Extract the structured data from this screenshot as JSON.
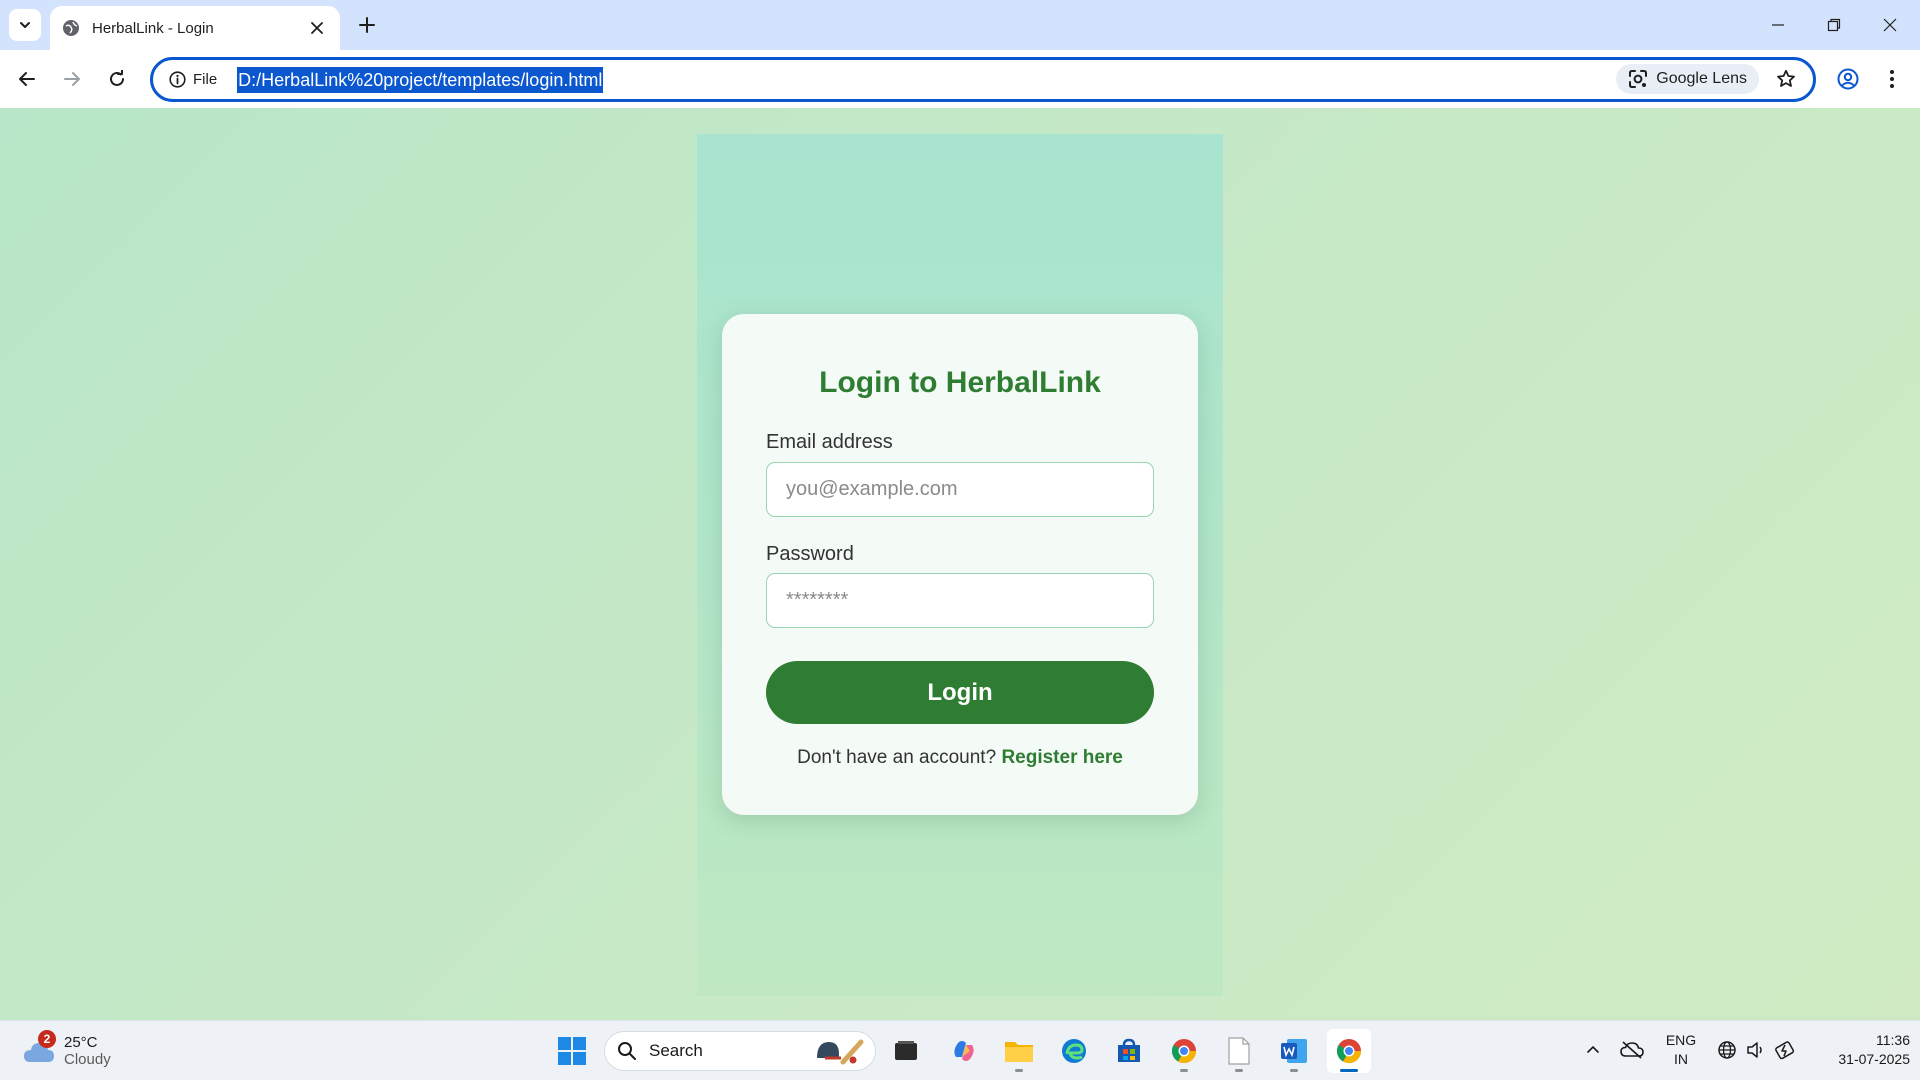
{
  "browser": {
    "tab_title": "HerbalLink - Login",
    "url": "D:/HerbalLink%20project/templates/login.html",
    "site_info_label": "File",
    "google_lens_label": "Google Lens"
  },
  "login": {
    "title": "Login to HerbalLink",
    "email_label": "Email address",
    "email_placeholder": "you@example.com",
    "password_label": "Password",
    "password_placeholder": "********",
    "login_button": "Login",
    "register_prompt": "Don't have an account?",
    "register_link": "Register here"
  },
  "taskbar": {
    "weather_temp": "25°C",
    "weather_condition": "Cloudy",
    "weather_badge": "2",
    "search_label": "Search",
    "language_line1": "ENG",
    "language_line2": "IN",
    "time": "11:36",
    "date": "31-07-2025"
  },
  "colors": {
    "brand_green": "#2e7d32",
    "omnibox_accent": "#0b57d0",
    "input_border": "#9ad3b0"
  }
}
